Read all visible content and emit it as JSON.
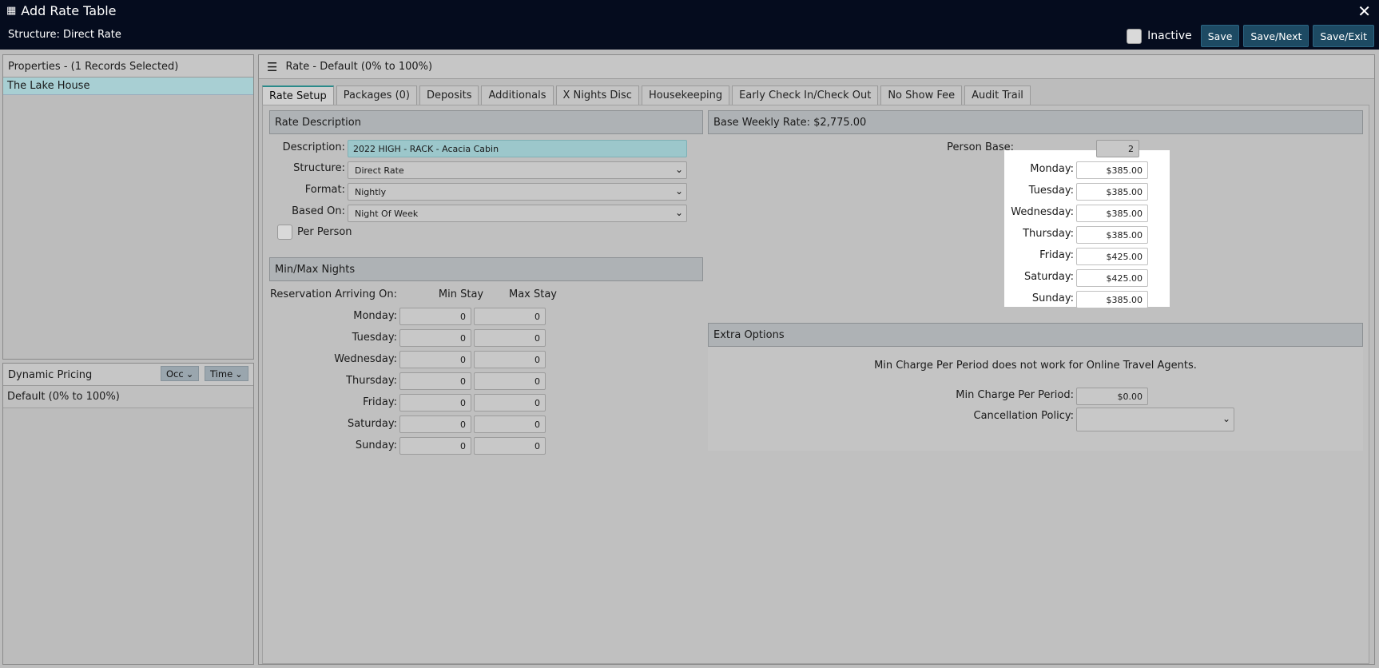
{
  "window": {
    "title": "Add Rate Table",
    "structure_line": "Structure: Direct Rate",
    "close_glyph": "✕",
    "calendar_glyph": "▦"
  },
  "top_actions": {
    "inactive_label": "Inactive",
    "save": "Save",
    "save_next": "Save/Next",
    "save_exit": "Save/Exit"
  },
  "properties": {
    "header": "Properties - (1 Records Selected)",
    "items": [
      "The Lake House"
    ]
  },
  "dynamic_pricing": {
    "header": "Dynamic Pricing",
    "occ_label": "Occ",
    "time_label": "Time",
    "items": [
      "Default (0% to 100%)"
    ]
  },
  "main": {
    "header": "Rate - Default (0% to 100%)",
    "tabs": [
      "Rate Setup",
      "Packages (0)",
      "Deposits",
      "Additionals",
      "X Nights Disc",
      "Housekeeping",
      "Early Check In/Check Out",
      "No Show Fee",
      "Audit Trail"
    ]
  },
  "rate_description": {
    "header": "Rate Description",
    "description_label": "Description:",
    "description_value": "2022 HIGH - RACK - Acacia Cabin",
    "structure_label": "Structure:",
    "structure_value": "Direct Rate",
    "format_label": "Format:",
    "format_value": "Nightly",
    "based_on_label": "Based On:",
    "based_on_value": "Night Of Week",
    "per_person_label": "Per Person"
  },
  "min_max": {
    "header": "Min/Max Nights",
    "arriving_label": "Reservation Arriving On:",
    "min_header": "Min Stay",
    "max_header": "Max Stay",
    "rows": [
      {
        "day": "Monday:",
        "min": "0",
        "max": "0"
      },
      {
        "day": "Tuesday:",
        "min": "0",
        "max": "0"
      },
      {
        "day": "Wednesday:",
        "min": "0",
        "max": "0"
      },
      {
        "day": "Thursday:",
        "min": "0",
        "max": "0"
      },
      {
        "day": "Friday:",
        "min": "0",
        "max": "0"
      },
      {
        "day": "Saturday:",
        "min": "0",
        "max": "0"
      },
      {
        "day": "Sunday:",
        "min": "0",
        "max": "0"
      }
    ]
  },
  "base_rate": {
    "header": "Base Weekly Rate: $2,775.00",
    "person_base_label": "Person Base:",
    "person_base_value": "2",
    "rows": [
      {
        "day": "Monday:",
        "value": "$385.00"
      },
      {
        "day": "Tuesday:",
        "value": "$385.00"
      },
      {
        "day": "Wednesday:",
        "value": "$385.00"
      },
      {
        "day": "Thursday:",
        "value": "$385.00"
      },
      {
        "day": "Friday:",
        "value": "$425.00"
      },
      {
        "day": "Saturday:",
        "value": "$425.00"
      },
      {
        "day": "Sunday:",
        "value": "$385.00"
      }
    ]
  },
  "extra_options": {
    "header": "Extra Options",
    "notice": "Min Charge Per Period does not work for Online Travel Agents.",
    "min_charge_label": "Min Charge Per Period:",
    "min_charge_value": "$0.00",
    "cancellation_label": "Cancellation Policy:",
    "cancellation_value": ""
  }
}
